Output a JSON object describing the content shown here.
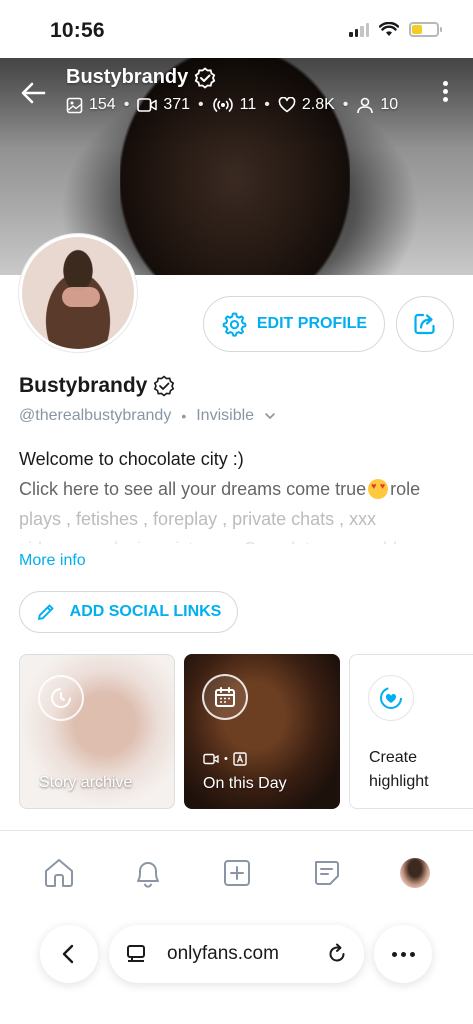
{
  "status": {
    "time": "10:56"
  },
  "cover": {
    "name": "Bustybrandy",
    "stats": {
      "photos": "154",
      "videos": "371",
      "streams": "11",
      "likes": "2.8K",
      "fans": "10"
    }
  },
  "profile": {
    "edit_label": "EDIT PROFILE",
    "display_name": "Bustybrandy",
    "handle": "@therealbustybrandy",
    "visibility": "Invisible",
    "bio_line1": "Welcome to chocolate city :)",
    "bio_line2_a": "Click here to see all your dreams come true",
    "bio_line2_b": " role",
    "bio_line3": "plays , fetishes , foreplay , private chats , xxx",
    "bio_line4": "videos , exclusive pictures . Complete my world",
    "more_info": "More info",
    "social_label": "ADD SOCIAL LINKS"
  },
  "highlights": {
    "story_archive": "Story archive",
    "on_this_day": "On this Day",
    "create_line1": "Create",
    "create_line2": "highlight"
  },
  "browser": {
    "url": "onlyfans.com"
  },
  "colors": {
    "accent": "#00aff0",
    "muted": "#8a96a3"
  }
}
